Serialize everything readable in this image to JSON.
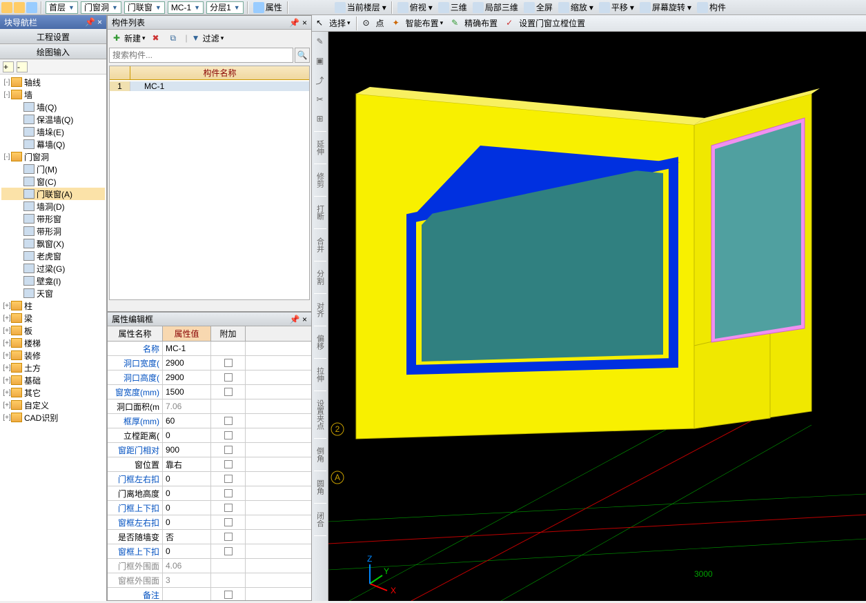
{
  "top": {
    "dd1": "首层",
    "dd2": "门窗洞",
    "dd3": "门联窗",
    "dd4": "MC-1",
    "dd5": "分层1",
    "b1": "属性",
    "b2": "当前楼层",
    "b3": "俯视",
    "b4": "三维",
    "b5": "局部三维",
    "b6": "全屏",
    "b7": "缩放",
    "b8": "平移",
    "b9": "屏幕旋转",
    "b10": "构件"
  },
  "sub": {
    "b1": "选择",
    "b2": "点",
    "b3": "智能布置",
    "b4": "精确布置",
    "b5": "设置门窗立樘位置"
  },
  "nav": {
    "title": "块导航栏",
    "tab1": "工程设置",
    "tab2": "绘图输入",
    "items": [
      {
        "lvl": 0,
        "exp": "-",
        "t": "轴线",
        "f": 1
      },
      {
        "lvl": 0,
        "exp": "-",
        "t": "墙",
        "f": 1
      },
      {
        "lvl": 1,
        "t": "墙(Q)"
      },
      {
        "lvl": 1,
        "t": "保温墙(Q)"
      },
      {
        "lvl": 1,
        "t": "墙垛(E)"
      },
      {
        "lvl": 1,
        "t": "幕墙(Q)"
      },
      {
        "lvl": 0,
        "exp": "-",
        "t": "门窗洞",
        "f": 1
      },
      {
        "lvl": 1,
        "t": "门(M)"
      },
      {
        "lvl": 1,
        "t": "窗(C)"
      },
      {
        "lvl": 1,
        "t": "门联窗(A)",
        "sel": 1
      },
      {
        "lvl": 1,
        "t": "墙洞(D)"
      },
      {
        "lvl": 1,
        "t": "带形窗"
      },
      {
        "lvl": 1,
        "t": "带形洞"
      },
      {
        "lvl": 1,
        "t": "飘窗(X)"
      },
      {
        "lvl": 1,
        "t": "老虎窗"
      },
      {
        "lvl": 1,
        "t": "过梁(G)"
      },
      {
        "lvl": 1,
        "t": "壁龛(I)"
      },
      {
        "lvl": 1,
        "t": "天窗"
      },
      {
        "lvl": 0,
        "exp": "+",
        "t": "柱",
        "f": 1
      },
      {
        "lvl": 0,
        "exp": "+",
        "t": "梁",
        "f": 1
      },
      {
        "lvl": 0,
        "exp": "+",
        "t": "板",
        "f": 1
      },
      {
        "lvl": 0,
        "exp": "+",
        "t": "楼梯",
        "f": 1
      },
      {
        "lvl": 0,
        "exp": "+",
        "t": "装修",
        "f": 1
      },
      {
        "lvl": 0,
        "exp": "+",
        "t": "土方",
        "f": 1
      },
      {
        "lvl": 0,
        "exp": "+",
        "t": "基础",
        "f": 1
      },
      {
        "lvl": 0,
        "exp": "+",
        "t": "其它",
        "f": 1
      },
      {
        "lvl": 0,
        "exp": "+",
        "t": "自定义",
        "f": 1
      },
      {
        "lvl": 0,
        "exp": "+",
        "t": "CAD识别",
        "f": 1
      }
    ]
  },
  "comp": {
    "title": "构件列表",
    "new": "新建",
    "filter": "过滤",
    "search_ph": "搜索构件...",
    "col": "构件名称",
    "rows": [
      {
        "i": "1",
        "n": "MC-1"
      }
    ]
  },
  "prop": {
    "title": "属性编辑框",
    "h1": "属性名称",
    "h2": "属性值",
    "h3": "附加",
    "rows": [
      {
        "n": "名称",
        "v": "MC-1",
        "c": "b"
      },
      {
        "n": "洞口宽度(",
        "v": "2900",
        "c": "b",
        "a": 1
      },
      {
        "n": "洞口高度(",
        "v": "2900",
        "c": "b",
        "a": 1
      },
      {
        "n": "窗宽度(mm)",
        "v": "1500",
        "c": "b",
        "a": 1
      },
      {
        "n": "洞口面积(m",
        "v": "7.06",
        "c": "k",
        "g": 1
      },
      {
        "n": "框厚(mm)",
        "v": "60",
        "c": "b",
        "a": 1
      },
      {
        "n": "立樘距离(",
        "v": "0",
        "c": "k",
        "a": 1
      },
      {
        "n": "窗距门相对",
        "v": "900",
        "c": "b",
        "a": 1
      },
      {
        "n": "窗位置",
        "v": "靠右",
        "c": "k",
        "a": 1
      },
      {
        "n": "门框左右扣",
        "v": "0",
        "c": "b",
        "a": 1
      },
      {
        "n": "门离地高度",
        "v": "0",
        "c": "k",
        "a": 1
      },
      {
        "n": "门框上下扣",
        "v": "0",
        "c": "b",
        "a": 1
      },
      {
        "n": "窗框左右扣",
        "v": "0",
        "c": "b",
        "a": 1
      },
      {
        "n": "是否随墙变",
        "v": "否",
        "c": "k",
        "a": 1
      },
      {
        "n": "窗框上下扣",
        "v": "0",
        "c": "b",
        "a": 1
      },
      {
        "n": "门框外围面",
        "v": "4.06",
        "c": "g",
        "g": 1
      },
      {
        "n": "窗框外围面",
        "v": "3",
        "c": "g",
        "g": 1
      },
      {
        "n": "备注",
        "v": "",
        "c": "b",
        "a": 1
      }
    ]
  },
  "vtb": [
    "延伸",
    "修剪",
    "打断",
    "合并",
    "分割",
    "对齐",
    "偏移",
    "拉伸",
    "设置夹点",
    "倒角",
    "圆角",
    "闭合"
  ],
  "view": {
    "axis2": "2",
    "axisA": "A",
    "dim": "3000",
    "x": "X",
    "y": "Y",
    "z": "Z"
  }
}
